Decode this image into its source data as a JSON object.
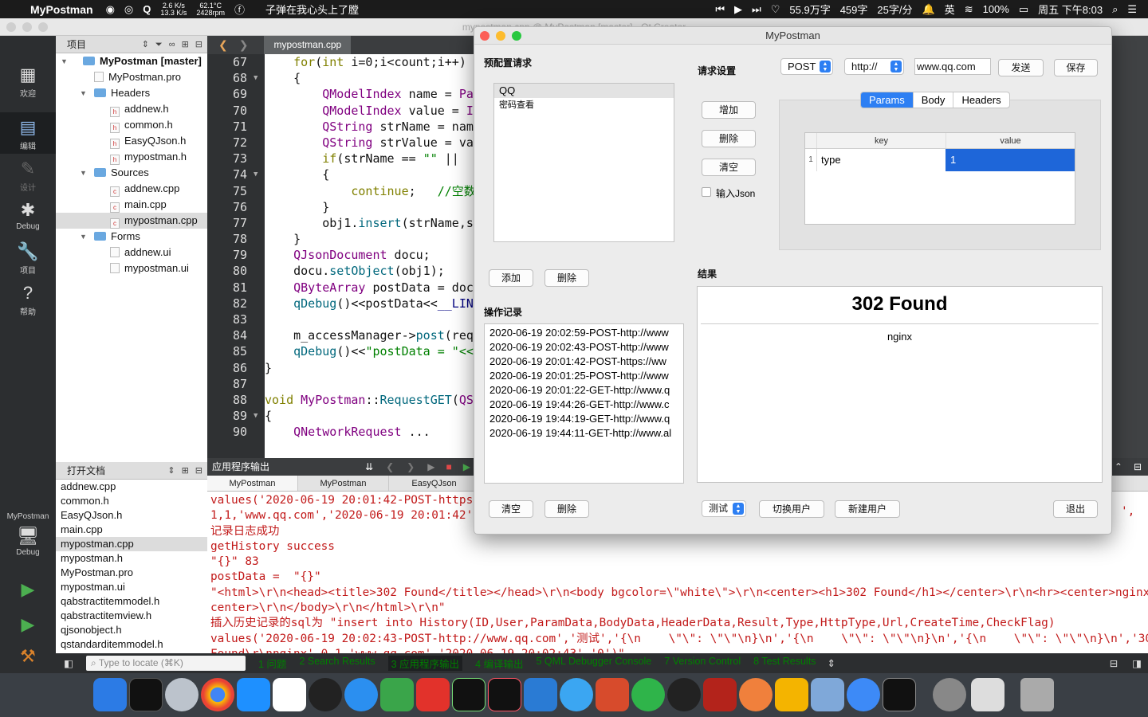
{
  "menubar": {
    "app": "MyPostman",
    "net_up": "2.6 K/s",
    "net_down": "13.3 K/s",
    "temp": "62.1°C",
    "rpm": "2428rpm",
    "song": "子弹在我心头上了膛",
    "words": "55.9万字",
    "wpm_a": "459字",
    "wpm_b": "25字/分",
    "ime": "英",
    "battery": "100%",
    "clock": "周五 下午8:03"
  },
  "qtcreator": {
    "title": "mypostman.cpp @ MyPostman [master] - Qt Creator",
    "modes": [
      {
        "label": "欢迎",
        "icon": "grid-icon"
      },
      {
        "label": "编辑",
        "icon": "edit-icon"
      },
      {
        "label": "设计",
        "icon": "pencil-icon"
      },
      {
        "label": "Debug",
        "icon": "bug-icon"
      },
      {
        "label": "项目",
        "icon": "wrench-icon"
      },
      {
        "label": "帮助",
        "icon": "help-icon"
      }
    ],
    "kit": {
      "project": "MyPostman",
      "config": "Debug"
    },
    "project_pane": {
      "header": "项目",
      "tree": [
        {
          "label": "MyPostman [master]",
          "depth": 0,
          "kind": "project",
          "arrow": "▼",
          "bold": true
        },
        {
          "label": "MyPostman.pro",
          "depth": 1,
          "kind": "pro"
        },
        {
          "label": "Headers",
          "depth": 1,
          "kind": "folder",
          "arrow": "▼"
        },
        {
          "label": "addnew.h",
          "depth": 2,
          "kind": "h"
        },
        {
          "label": "common.h",
          "depth": 2,
          "kind": "h"
        },
        {
          "label": "EasyQJson.h",
          "depth": 2,
          "kind": "h"
        },
        {
          "label": "mypostman.h",
          "depth": 2,
          "kind": "h"
        },
        {
          "label": "Sources",
          "depth": 1,
          "kind": "folder",
          "arrow": "▼"
        },
        {
          "label": "addnew.cpp",
          "depth": 2,
          "kind": "cpp"
        },
        {
          "label": "main.cpp",
          "depth": 2,
          "kind": "cpp"
        },
        {
          "label": "mypostman.cpp",
          "depth": 2,
          "kind": "cpp",
          "selected": true
        },
        {
          "label": "Forms",
          "depth": 1,
          "kind": "folder",
          "arrow": "▼"
        },
        {
          "label": "addnew.ui",
          "depth": 2,
          "kind": "ui"
        },
        {
          "label": "mypostman.ui",
          "depth": 2,
          "kind": "ui"
        }
      ]
    },
    "open_docs": {
      "header": "打开文档",
      "items": [
        "addnew.cpp",
        "common.h",
        "EasyQJson.h",
        "main.cpp",
        "mypostman.cpp",
        "mypostman.h",
        "MyPostman.pro",
        "mypostman.ui",
        "qabstractitemmodel.h",
        "qabstractitemview.h",
        "qjsonobject.h",
        "qstandarditemmodel.h",
        "qwidget.h"
      ],
      "selected": 4
    },
    "editor": {
      "filename": "mypostman.cpp",
      "line_numbers": [
        "67",
        "68",
        "69",
        "70",
        "71",
        "72",
        "73",
        "74",
        "75",
        "76",
        "77",
        "78",
        "79",
        "80",
        "81",
        "82",
        "83",
        "84",
        "85",
        "86",
        "87",
        "88",
        "89",
        "90"
      ],
      "fold_lines": [
        "68",
        "74",
        "89"
      ]
    },
    "output": {
      "header": "应用程序输出",
      "tabs": [
        "MyPostman",
        "MyPostman",
        "EasyQJson"
      ],
      "lines": [
        "values('2020-06-19 20:01:42-POST-https:",
        "1,1,'www.qq.com','2020-06-19 20:01:42',",
        "记录日志成功",
        "getHistory success",
        "\"{}\" 83",
        "postData =  \"{}\"",
        "\"<html>\\r\\n<head><title>302 Found</title></head>\\r\\n<body bgcolor=\\\"white\\\">\\r\\n<center><h1>302 Found</h1></center>\\r\\n<hr><center>nginx</",
        "center>\\r\\n</body>\\r\\n</html>\\r\\n\"",
        "插入历史记录的sql为 \"insert into History(ID,User,ParamData,BodyData,HeaderData,Result,Type,HttpType,Url,CreateTime,CheckFlag)",
        "values('2020-06-19 20:02:43-POST-http://www.qq.com','测试','{\\n    \\\"\\\": \\\"\\\"\\n}\\n','{\\n    \\\"\\\": \\\"\\\"\\n}\\n','{\\n    \\\"\\\": \\\"\\\"\\n}\\n','302",
        "Found\\r\\nnginx',0,1,'www.qq.com','2020-06-19 20:02:43','0')\""
      ],
      "right_fragment": "',"
    },
    "statusbar": {
      "locator_placeholder": "Type to locate (⌘K)",
      "tabs": [
        "1 问题",
        "2 Search Results",
        "3 应用程序输出",
        "4 编译输出",
        "5 QML Debugger Console",
        "7 Version Control",
        "8 Test Results"
      ]
    }
  },
  "mypostman": {
    "title": "MyPostman",
    "preset_label": "预配置请求",
    "preset_items": [
      "QQ",
      "密码查看"
    ],
    "preset_add": "添加",
    "preset_delete": "删除",
    "log_label": "操作记录",
    "log_items": [
      "2020-06-19 20:02:59-POST-http://www",
      "2020-06-19 20:02:43-POST-http://www",
      "2020-06-19 20:01:42-POST-https://ww",
      "2020-06-19 20:01:25-POST-http://www",
      "2020-06-19 20:01:22-GET-http://www.q",
      "2020-06-19 19:44:26-GET-http://www.c",
      "2020-06-19 19:44:19-GET-http://www.q",
      "2020-06-19 19:44:11-GET-http://www.al"
    ],
    "log_clear": "清空",
    "log_delete": "删除",
    "req_label": "请求设置",
    "method": "POST",
    "scheme": "http://",
    "url": "www.qq.com",
    "send": "发送",
    "save": "保存",
    "add": "增加",
    "remove": "删除",
    "clear": "清空",
    "json_checkbox": "输入Json",
    "tabs": [
      "Params",
      "Body",
      "Headers"
    ],
    "active_tab": 0,
    "table": {
      "headers": [
        "key",
        "value"
      ],
      "rows": [
        {
          "n": "1",
          "key": "type",
          "value": "1"
        }
      ]
    },
    "result_label": "结果",
    "result_title": "302 Found",
    "result_body": "nginx",
    "user": "测试",
    "switch_user": "切换用户",
    "new_user": "新建用户",
    "exit": "退出"
  }
}
